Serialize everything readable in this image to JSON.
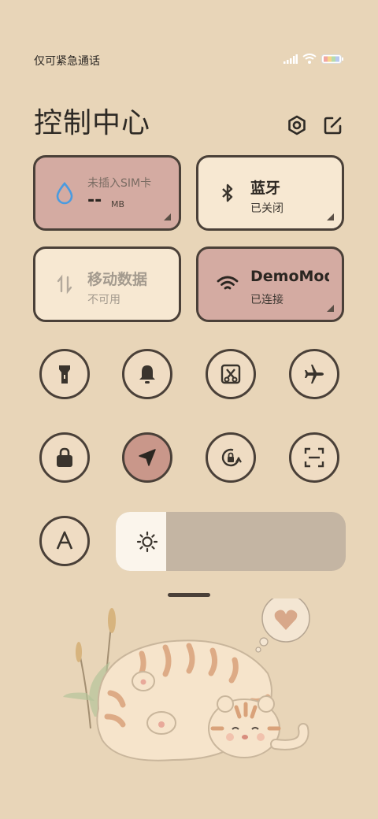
{
  "status": {
    "carrier": "仅可紧急通话",
    "icons": [
      "signal-icon",
      "wifi-icon",
      "battery-icon"
    ]
  },
  "header": {
    "title": "控制中心",
    "settings_icon": "gear-icon",
    "edit_icon": "edit-icon"
  },
  "tiles": {
    "data_usage": {
      "label": "未插入SIM卡",
      "value": "--",
      "unit": "MB",
      "icon": "water-drop-icon"
    },
    "bluetooth": {
      "label": "蓝牙",
      "status": "已关闭",
      "icon": "bluetooth-icon"
    },
    "mobile_data": {
      "label": "移动数据",
      "status": "不可用",
      "icon": "data-transfer-icon"
    },
    "wifi": {
      "label": "DemoMode",
      "status": "已连接",
      "icon": "wifi-icon"
    }
  },
  "toggles": [
    {
      "name": "flashlight",
      "icon": "flashlight-icon",
      "active": false
    },
    {
      "name": "ringer",
      "icon": "bell-icon",
      "active": false
    },
    {
      "name": "screenshot",
      "icon": "scissors-icon",
      "active": false
    },
    {
      "name": "airplane-mode",
      "icon": "airplane-icon",
      "active": false
    },
    {
      "name": "lock-screen",
      "icon": "lock-icon",
      "active": false
    },
    {
      "name": "location",
      "icon": "location-arrow-icon",
      "active": true
    },
    {
      "name": "auto-rotate",
      "icon": "rotation-lock-icon",
      "active": false
    },
    {
      "name": "scanner",
      "icon": "scan-icon",
      "active": false
    },
    {
      "name": "auto-brightness",
      "icon": "letter-a-icon",
      "active": false
    }
  ],
  "brightness": {
    "level": 0.22,
    "icon": "sun-icon"
  },
  "colors": {
    "background": "#e8d5b8",
    "tile_active": "#d4aba2",
    "tile_inactive": "#f7e8d2",
    "outline": "#4a4038",
    "toggle_active": "#c9978a"
  }
}
